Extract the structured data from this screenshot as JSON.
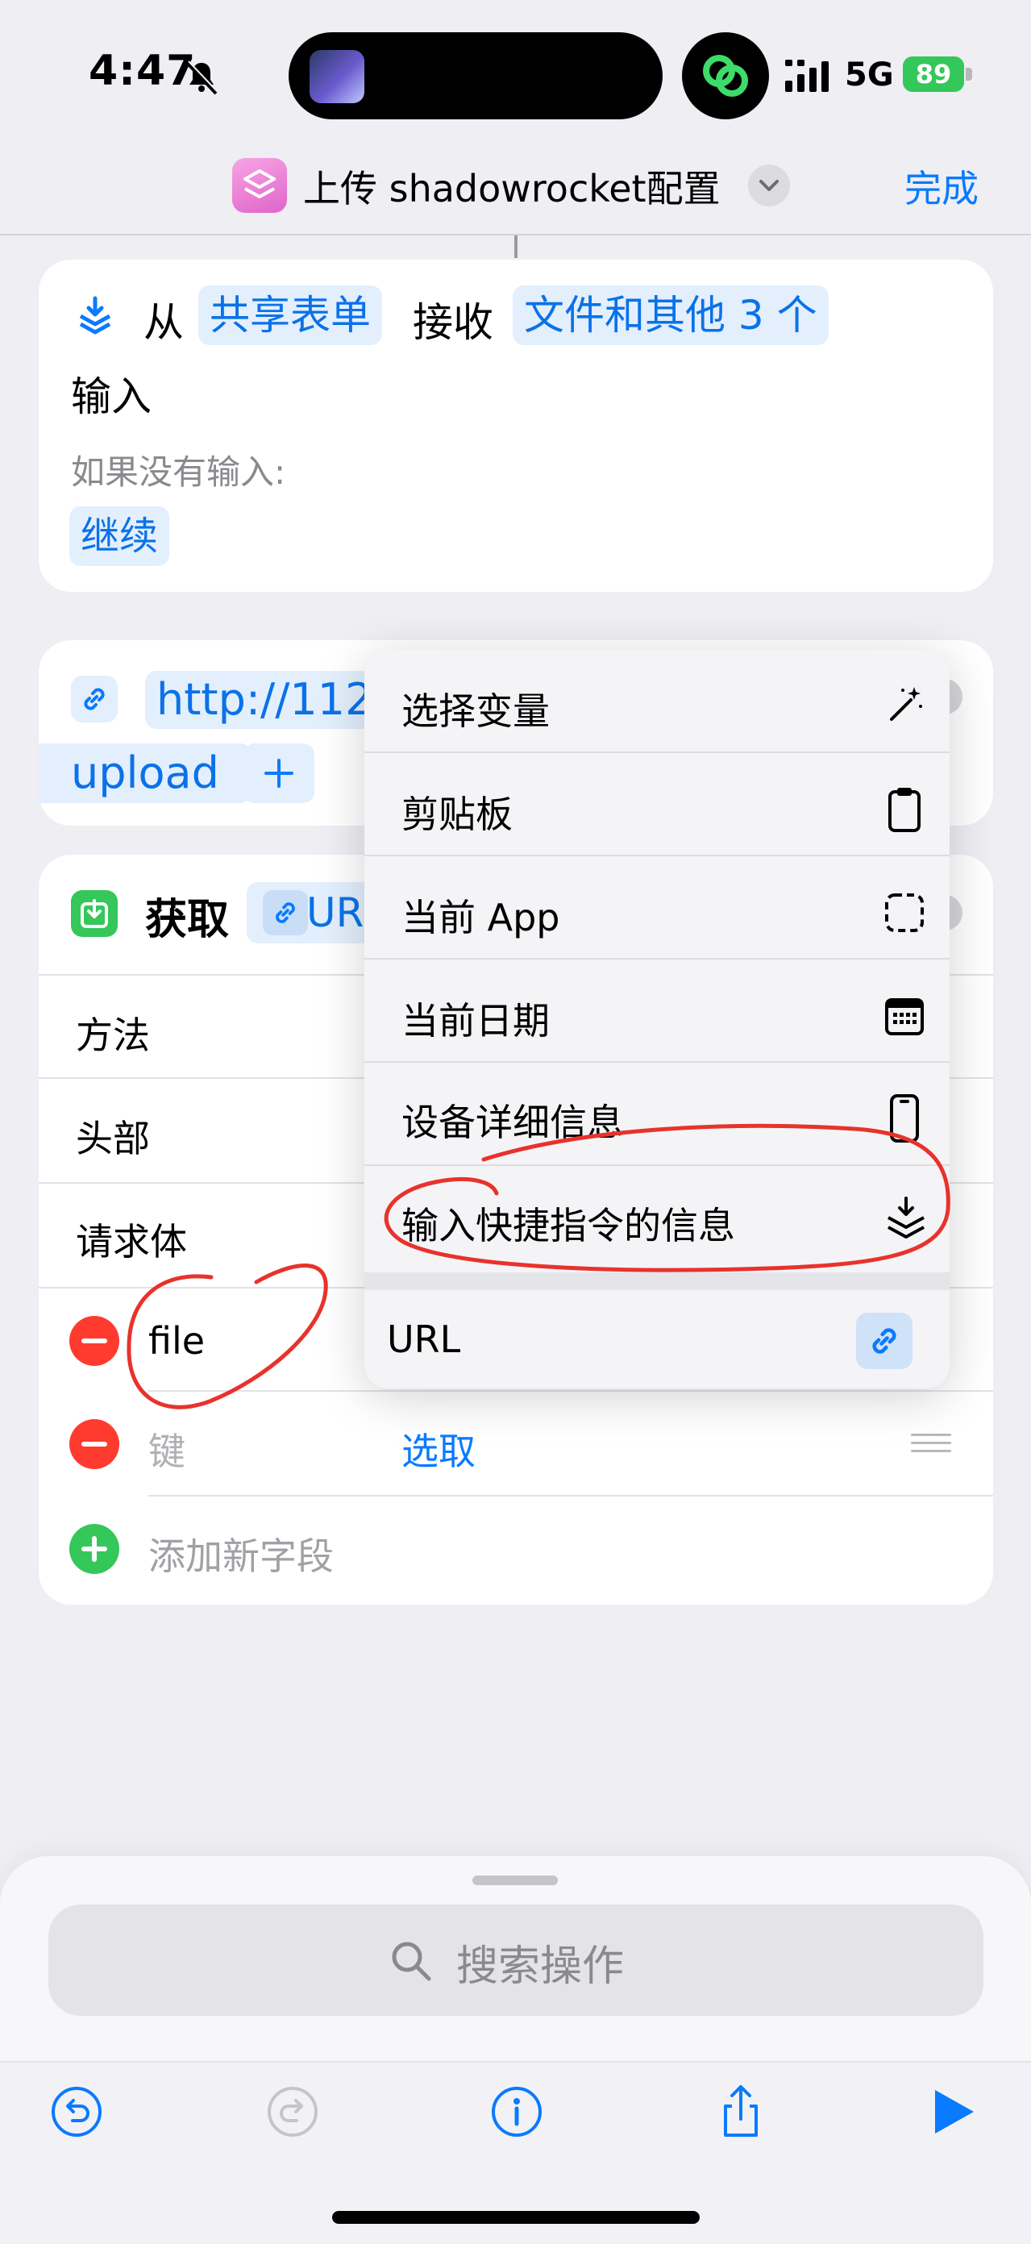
{
  "status_bar": {
    "time": "4:47",
    "network": "5G",
    "battery": "89"
  },
  "nav": {
    "title": "上传 shadowrocket配置",
    "done_label": "完成"
  },
  "receive_card": {
    "from_label": "从",
    "source_chip": "共享表单",
    "receive_label": "接收",
    "types_chip": "文件和其他 3 个",
    "input_label": "输入",
    "if_no_input_label": "如果没有输入:",
    "continue_chip": "继续"
  },
  "url_card": {
    "url_text": "http://112.",
    "path_text": "upload",
    "add_label": "+"
  },
  "get_card": {
    "get_label": "获取",
    "url_chip": "UR",
    "rows": {
      "method": "方法",
      "headers": "头部",
      "body": "请求体"
    },
    "field_key": "file",
    "key_placeholder": "键",
    "choose_label": "选取",
    "add_field_label": "添加新字段"
  },
  "menu": {
    "items": [
      {
        "label": "选择变量",
        "icon": "magic-wand-icon"
      },
      {
        "label": "剪贴板",
        "icon": "clipboard-icon"
      },
      {
        "label": "当前 App",
        "icon": "app-frame-icon"
      },
      {
        "label": "当前日期",
        "icon": "calendar-icon"
      },
      {
        "label": "设备详细信息",
        "icon": "phone-icon"
      },
      {
        "label": "输入快捷指令的信息",
        "icon": "shortcut-input-icon"
      },
      {
        "label": "URL",
        "icon": "link-icon"
      }
    ]
  },
  "search": {
    "placeholder": "搜索操作"
  },
  "toolbar": {
    "icons": [
      "undo-icon",
      "redo-icon",
      "info-icon",
      "share-icon",
      "play-icon"
    ]
  },
  "colors": {
    "accent": "#0a7aff",
    "annotation": "#e8322c",
    "delete": "#ff3b30",
    "add": "#34c759"
  }
}
